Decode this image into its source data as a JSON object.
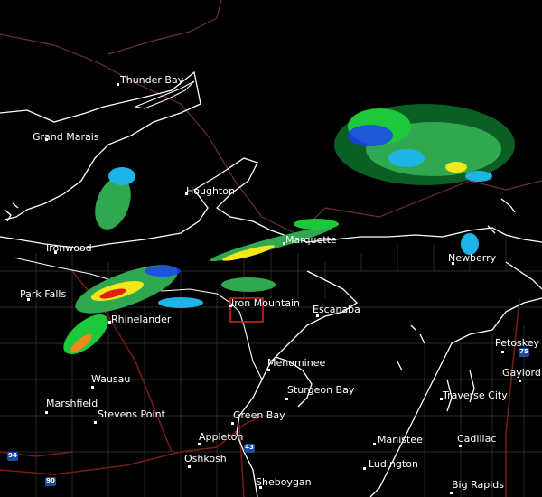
{
  "cities": [
    {
      "id": "thunder-bay",
      "name": "Thunder Bay"
    },
    {
      "id": "grand-marais",
      "name": "Grand Marais"
    },
    {
      "id": "houghton",
      "name": "Houghton"
    },
    {
      "id": "marquette",
      "name": "Marquette"
    },
    {
      "id": "newberry",
      "name": "Newberry"
    },
    {
      "id": "ironwood",
      "name": "Ironwood"
    },
    {
      "id": "park-falls",
      "name": "Park Falls"
    },
    {
      "id": "rhinelander",
      "name": "Rhinelander"
    },
    {
      "id": "iron-mountain",
      "name": "Iron Mountain"
    },
    {
      "id": "escanaba",
      "name": "Escanaba"
    },
    {
      "id": "petoskey",
      "name": "Petoskey"
    },
    {
      "id": "gaylord",
      "name": "Gaylord"
    },
    {
      "id": "wausau",
      "name": "Wausau"
    },
    {
      "id": "menominee",
      "name": "Menominee"
    },
    {
      "id": "marshfield",
      "name": "Marshfield"
    },
    {
      "id": "sturgeon-bay",
      "name": "Sturgeon Bay"
    },
    {
      "id": "traverse-city",
      "name": "Traverse City"
    },
    {
      "id": "stevens-point",
      "name": "Stevens Point"
    },
    {
      "id": "green-bay",
      "name": "Green Bay"
    },
    {
      "id": "appleton",
      "name": "Appleton"
    },
    {
      "id": "manistee",
      "name": "Manistee"
    },
    {
      "id": "cadillac",
      "name": "Cadillac"
    },
    {
      "id": "oshkosh",
      "name": "Oshkosh"
    },
    {
      "id": "ludington",
      "name": "Ludington"
    },
    {
      "id": "sheboygan",
      "name": "Sheboygan"
    },
    {
      "id": "big-rapids",
      "name": "Big Rapids"
    }
  ],
  "shields": [
    {
      "id": "i-75",
      "label": "75",
      "color": "#1a4fa0"
    },
    {
      "id": "i-43",
      "label": "43",
      "color": "#1a4fa0"
    },
    {
      "id": "i-94",
      "label": "94",
      "color": "#1a4fa0"
    },
    {
      "id": "i-90",
      "label": "90",
      "color": "#1a4fa0"
    }
  ],
  "colors": {
    "background": "#000000",
    "coastline": "#ffffff",
    "state_border": "#ffffff",
    "county_border": "#3a3a3a",
    "country_border": "#6b3030",
    "highway": "#7a1c1c",
    "warning_box": "#d02020",
    "radar_light": "#2fa84f",
    "radar_green": "#1ec83c",
    "radar_dark": "#0d6e2a",
    "radar_blue": "#1b3cff",
    "radar_cyan": "#1fb4e8",
    "radar_yellow": "#f4e81a",
    "radar_orange": "#f08a1c",
    "radar_red": "#e02010"
  }
}
